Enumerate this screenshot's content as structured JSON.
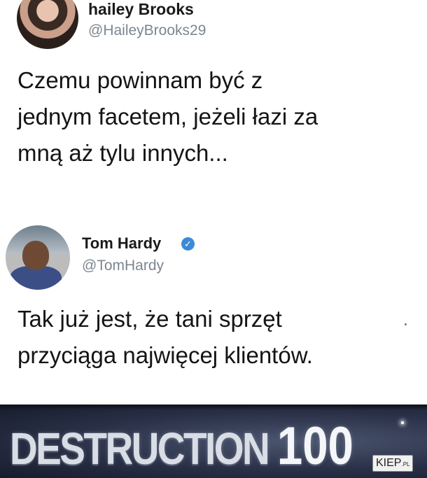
{
  "tweet1": {
    "name": "hailey Brooks",
    "handle": "@HaileyBrooks29",
    "text_lines": [
      "Czemu powinnam być z",
      "jednym facetem, jeżeli łazi za",
      "mną aż tylu innych..."
    ]
  },
  "tweet2": {
    "name": "Tom Hardy",
    "handle": "@TomHardy",
    "verified_icon": "check",
    "text_lines": [
      "Tak już jest, że tani sprzęt",
      "przyciąga najwięcej klientów."
    ]
  },
  "banner": {
    "word": "DESTRUCTION",
    "number": "100"
  },
  "watermark": {
    "brand": "KIEP",
    "suffix": ".PL"
  },
  "colors": {
    "handle": "#7c8690",
    "verified": "#3b8ad6",
    "banner_bg": "#293047"
  }
}
